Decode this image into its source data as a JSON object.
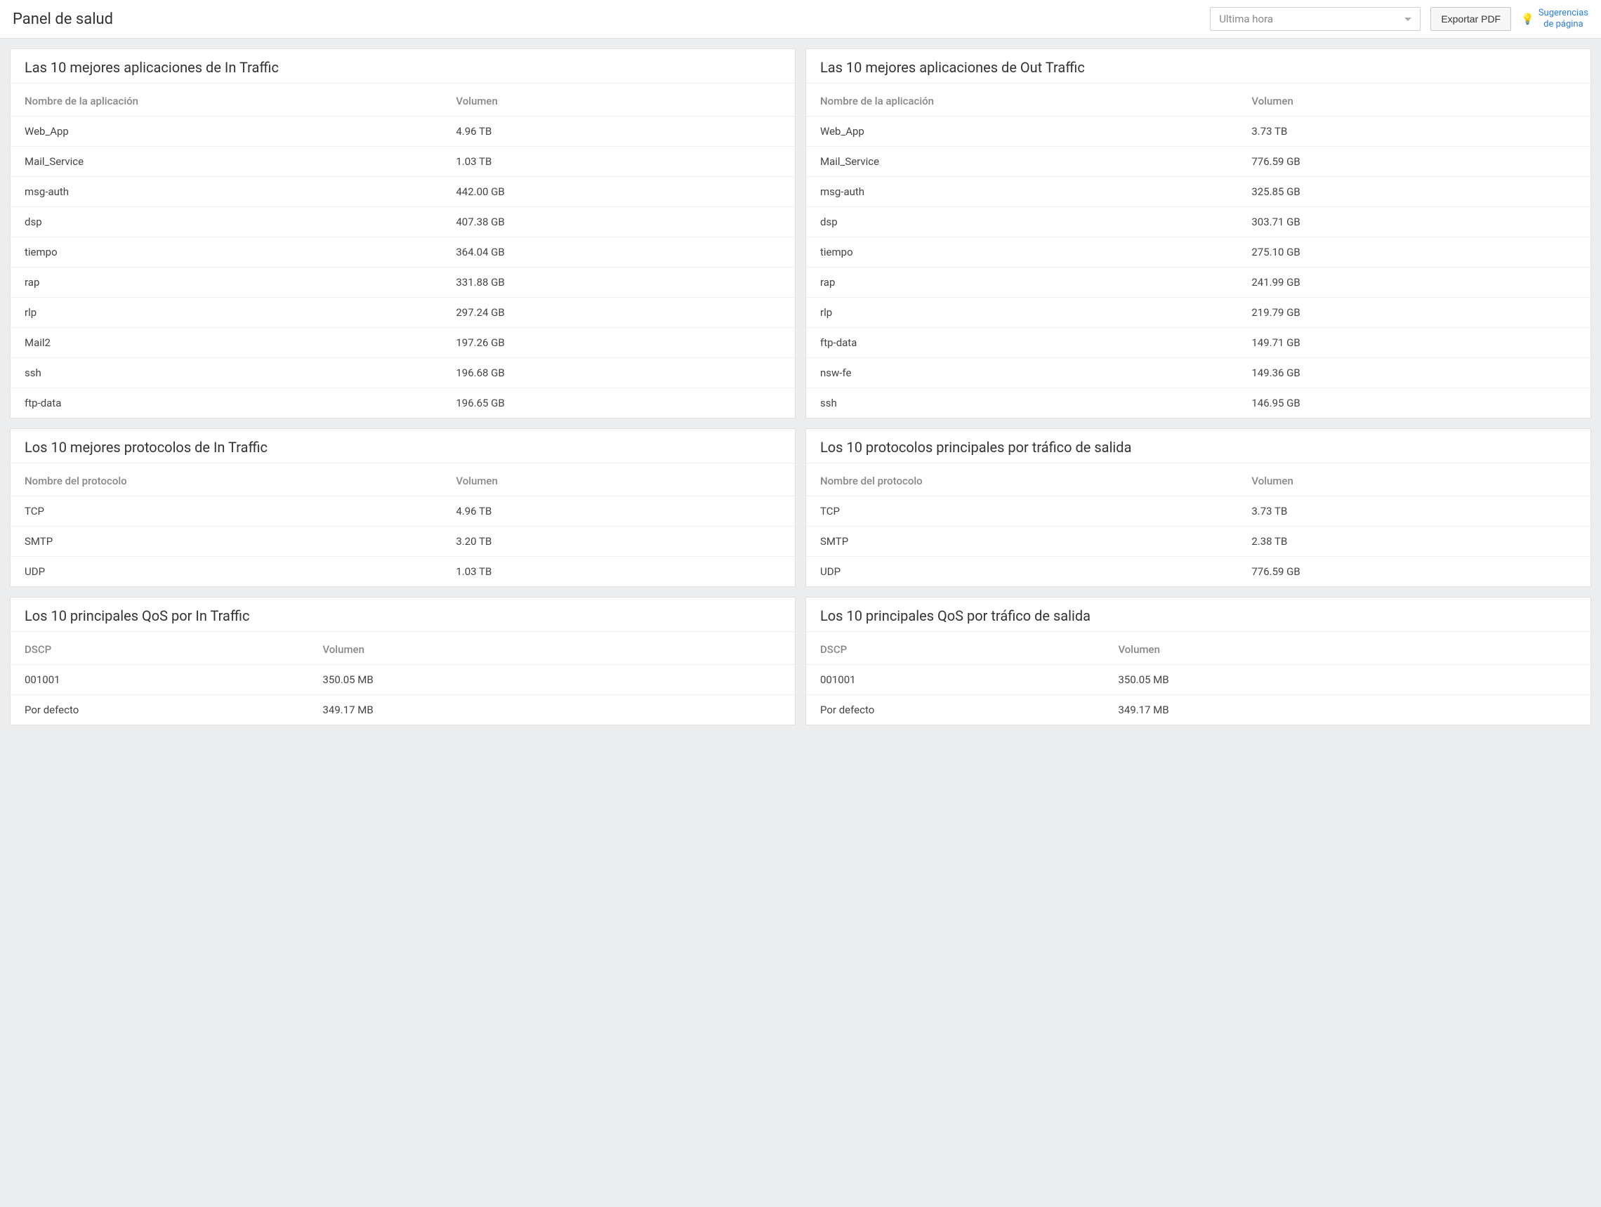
{
  "header": {
    "title": "Panel de salud",
    "time_range": "Ultima hora",
    "export_label": "Exportar PDF",
    "suggest_label_1": "Sugerencias",
    "suggest_label_2": "de página"
  },
  "panels": {
    "in_apps": {
      "title": "Las 10 mejores aplicaciones de In Traffic",
      "col_name": "Nombre de la aplicación",
      "col_vol": "Volumen",
      "rows": [
        {
          "name": "Web_App",
          "vol": "4.96 TB"
        },
        {
          "name": "Mail_Service",
          "vol": "1.03 TB"
        },
        {
          "name": "msg-auth",
          "vol": "442.00 GB"
        },
        {
          "name": "dsp",
          "vol": "407.38 GB"
        },
        {
          "name": "tiempo",
          "vol": "364.04 GB"
        },
        {
          "name": "rap",
          "vol": "331.88 GB"
        },
        {
          "name": "rlp",
          "vol": "297.24 GB"
        },
        {
          "name": "Mail2",
          "vol": "197.26 GB"
        },
        {
          "name": "ssh",
          "vol": "196.68 GB"
        },
        {
          "name": "ftp-data",
          "vol": "196.65 GB"
        }
      ]
    },
    "out_apps": {
      "title": "Las 10 mejores aplicaciones de Out Traffic",
      "col_name": "Nombre de la aplicación",
      "col_vol": "Volumen",
      "rows": [
        {
          "name": "Web_App",
          "vol": "3.73 TB"
        },
        {
          "name": "Mail_Service",
          "vol": "776.59 GB"
        },
        {
          "name": "msg-auth",
          "vol": "325.85 GB"
        },
        {
          "name": "dsp",
          "vol": "303.71 GB"
        },
        {
          "name": "tiempo",
          "vol": "275.10 GB"
        },
        {
          "name": "rap",
          "vol": "241.99 GB"
        },
        {
          "name": "rlp",
          "vol": "219.79 GB"
        },
        {
          "name": "ftp-data",
          "vol": "149.71 GB"
        },
        {
          "name": "nsw-fe",
          "vol": "149.36 GB"
        },
        {
          "name": "ssh",
          "vol": "146.95 GB"
        }
      ]
    },
    "in_proto": {
      "title": "Los 10 mejores protocolos de In Traffic",
      "col_name": "Nombre del protocolo",
      "col_vol": "Volumen",
      "rows": [
        {
          "name": "TCP",
          "vol": "4.96 TB"
        },
        {
          "name": "SMTP",
          "vol": "3.20 TB"
        },
        {
          "name": "UDP",
          "vol": "1.03 TB"
        }
      ]
    },
    "out_proto": {
      "title": "Los 10 protocolos principales por tráfico de salida",
      "col_name": "Nombre del protocolo",
      "col_vol": "Volumen",
      "rows": [
        {
          "name": "TCP",
          "vol": "3.73 TB"
        },
        {
          "name": "SMTP",
          "vol": "2.38 TB"
        },
        {
          "name": "UDP",
          "vol": "776.59 GB"
        }
      ]
    },
    "in_qos": {
      "title": "Los 10 principales QoS por In Traffic",
      "col_name": "DSCP",
      "col_vol": "Volumen",
      "rows": [
        {
          "name": "001001",
          "vol": "350.05 MB"
        },
        {
          "name": "Por defecto",
          "vol": "349.17 MB"
        }
      ]
    },
    "out_qos": {
      "title": "Los 10 principales QoS por tráfico de salida",
      "col_name": "DSCP",
      "col_vol": "Volumen",
      "rows": [
        {
          "name": "001001",
          "vol": "350.05 MB"
        },
        {
          "name": "Por defecto",
          "vol": "349.17 MB"
        }
      ]
    }
  }
}
